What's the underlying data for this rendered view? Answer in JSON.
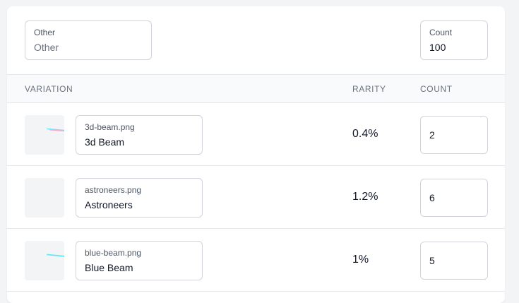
{
  "other_field": {
    "label": "Other",
    "placeholder": "Other",
    "value": ""
  },
  "count_field": {
    "label": "Count",
    "value": "100"
  },
  "table": {
    "headers": {
      "variation": "VARIATION",
      "rarity": "RARITY",
      "count": "COUNT"
    },
    "rows": [
      {
        "filename": "3d-beam.png",
        "name": "3d Beam",
        "rarity": "0.4%",
        "count": "2",
        "thumb": "beam-pink-blue"
      },
      {
        "filename": "astroneers.png",
        "name": "Astroneers",
        "rarity": "1.2%",
        "count": "6",
        "thumb": "blank"
      },
      {
        "filename": "blue-beam.png",
        "name": "Blue Beam",
        "rarity": "1%",
        "count": "5",
        "thumb": "beam-blue"
      }
    ]
  },
  "colors": {
    "beam_blue": "#67e8f9",
    "beam_pink": "#f9a8d4"
  }
}
